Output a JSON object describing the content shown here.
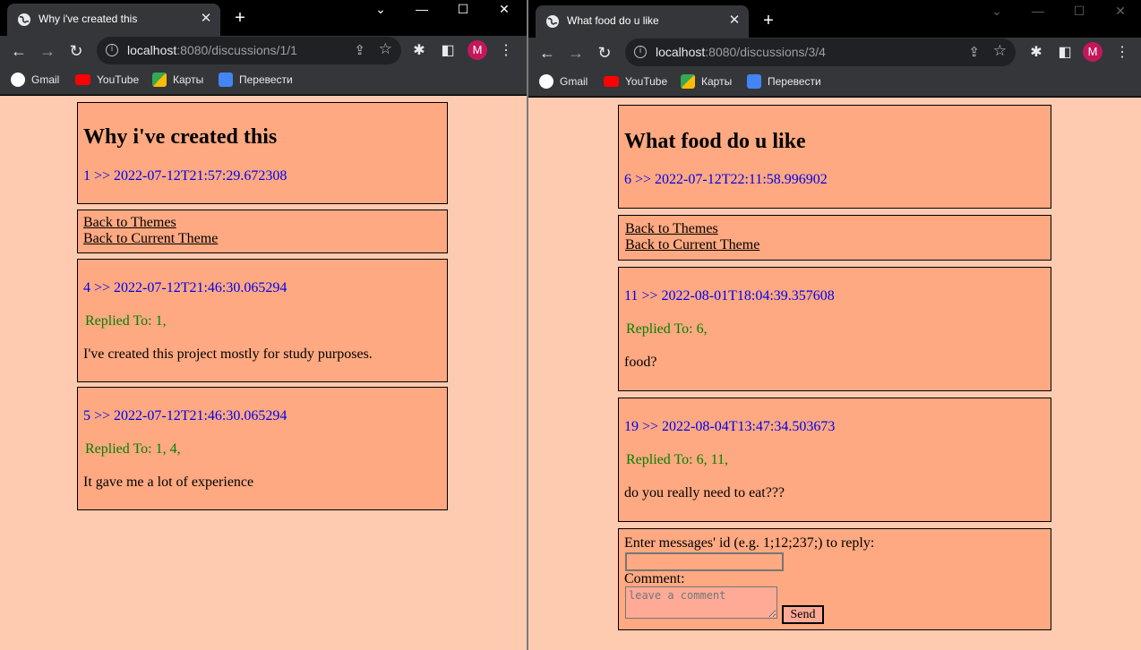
{
  "left": {
    "tab_title": "Why i've created this",
    "url_host": "localhost",
    "url_path": ":8080/discussions/1/1",
    "bookmarks": [
      "Gmail",
      "YouTube",
      "Карты",
      "Перевести"
    ],
    "avatar": "M",
    "header": {
      "title": "Why i've created this",
      "meta": "1 >> 2022-07-12T21:57:29.672308"
    },
    "nav": {
      "back_themes": "Back to Themes",
      "back_current": "Back to Current Theme"
    },
    "messages": [
      {
        "meta": "4 >> 2022-07-12T21:46:30.065294",
        "replied": "Replied To: 1,",
        "text": "I've created this project mostly for study purposes."
      },
      {
        "meta": "5 >> 2022-07-12T21:46:30.065294",
        "replied": "Replied To: 1, 4,",
        "text": "It gave me a lot of experience"
      }
    ]
  },
  "right": {
    "tab_title": "What food do u like",
    "url_host": "localhost",
    "url_path": ":8080/discussions/3/4",
    "bookmarks": [
      "Gmail",
      "YouTube",
      "Карты",
      "Перевести"
    ],
    "avatar": "M",
    "header": {
      "title": "What food do u like",
      "meta": "6 >> 2022-07-12T22:11:58.996902"
    },
    "nav": {
      "back_themes": "Back to Themes",
      "back_current": "Back to Current Theme"
    },
    "messages": [
      {
        "meta": "11 >> 2022-08-01T18:04:39.357608",
        "replied": "Replied To: 6,",
        "text": "food?"
      },
      {
        "meta": "19 >> 2022-08-04T13:47:34.503673",
        "replied": "Replied To: 6, 11,",
        "text": "do you really need to eat???"
      }
    ],
    "form": {
      "reply_label": "Enter messages' id (e.g. 1;12;237;) to reply:",
      "reply_value": "",
      "comment_label": "Comment:",
      "comment_placeholder": "leave a comment",
      "send_label": "Send"
    }
  },
  "colors": {
    "page_bg": "#fecbb1",
    "card_bg": "#fea981",
    "meta_link": "#0000ee",
    "reply_text": "#008000",
    "avatar": "#c2185b"
  }
}
